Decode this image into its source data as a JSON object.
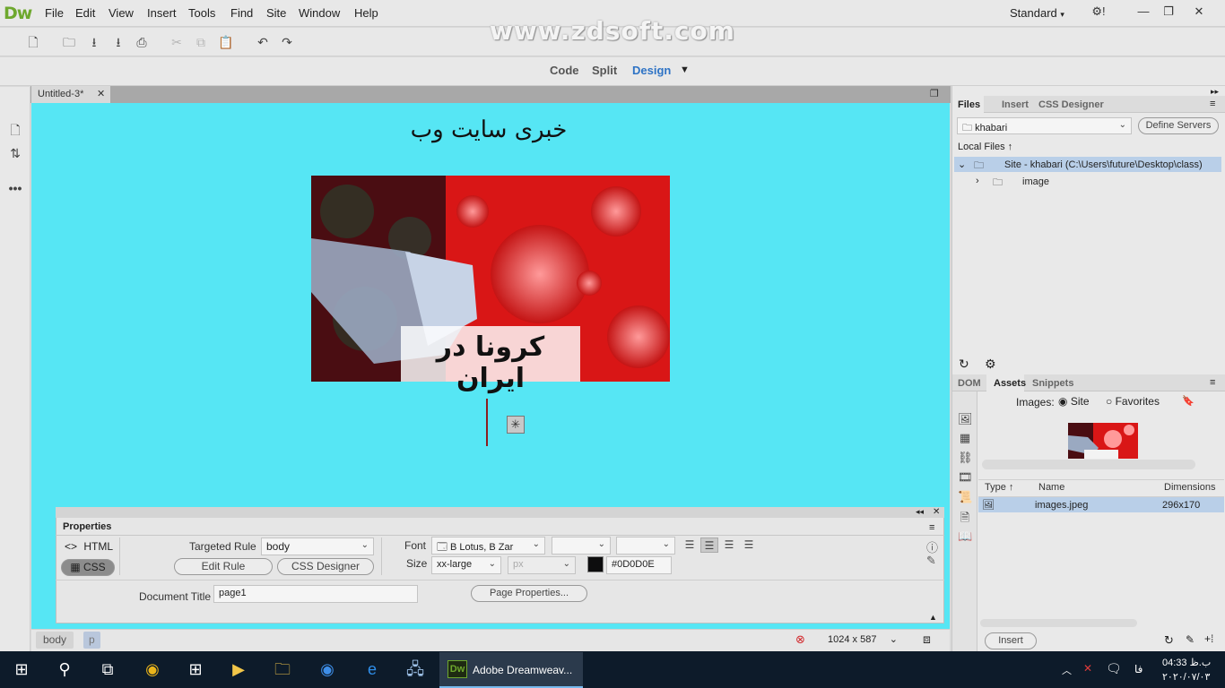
{
  "app": {
    "logo": "Dw",
    "workspace": "Standard",
    "watermark": "www.zdsoft.com"
  },
  "menu": [
    "File",
    "Edit",
    "View",
    "Insert",
    "Tools",
    "Find",
    "Site",
    "Window",
    "Help"
  ],
  "view_switcher": {
    "code": "Code",
    "split": "Split",
    "design": "Design",
    "active": "Design"
  },
  "document": {
    "tab_title": "Untitled-3*",
    "heading": "خبری سایت وب",
    "hero_caption": "کرونا در ایران"
  },
  "properties": {
    "title": "Properties",
    "html_label": "HTML",
    "css_label": "CSS",
    "targeted_rule_label": "Targeted Rule",
    "targeted_rule_value": "body",
    "edit_rule": "Edit Rule",
    "css_designer": "CSS Designer",
    "font_label": "Font",
    "font_value": "B Lotus, B Zar",
    "size_label": "Size",
    "size_value": "xx-large",
    "size_unit": "px",
    "color_value": "#0D0D0E",
    "document_title_label": "Document Title",
    "document_title_value": "page1",
    "page_properties": "Page Properties..."
  },
  "statusbar": {
    "tags": [
      "body",
      "p"
    ],
    "window_size": "1024 x 587"
  },
  "files_panel": {
    "tabs": [
      "Files",
      "Insert",
      "CSS Designer"
    ],
    "active_tab": "Files",
    "site_select": "khabari",
    "define_servers": "Define Servers",
    "local_files_label": "Local Files",
    "tree": [
      {
        "label": "Site - khabari (C:\\Users\\future\\Desktop\\class)",
        "level": 0,
        "selected": true
      },
      {
        "label": "image",
        "level": 1,
        "selected": false
      }
    ]
  },
  "assets_panel": {
    "tabs": [
      "DOM",
      "Assets",
      "Snippets"
    ],
    "active_tab": "Assets",
    "images_label": "Images:",
    "radio_site": "Site",
    "radio_favorites": "Favorites",
    "columns": [
      "Type",
      "Name",
      "Dimensions"
    ],
    "rows": [
      {
        "name": "images.jpeg",
        "dimensions": "296x170"
      }
    ],
    "insert_button": "Insert"
  },
  "taskbar": {
    "active_app": "Adobe Dreamweav...",
    "time": "04:33 ب.ظ",
    "date": "۲۰۲۰/۰۷/۰۳",
    "lang": "فا"
  },
  "colors": {
    "canvas": "#56e6f4",
    "accent": "#2e73c5",
    "dw_green": "#6ea82e"
  }
}
